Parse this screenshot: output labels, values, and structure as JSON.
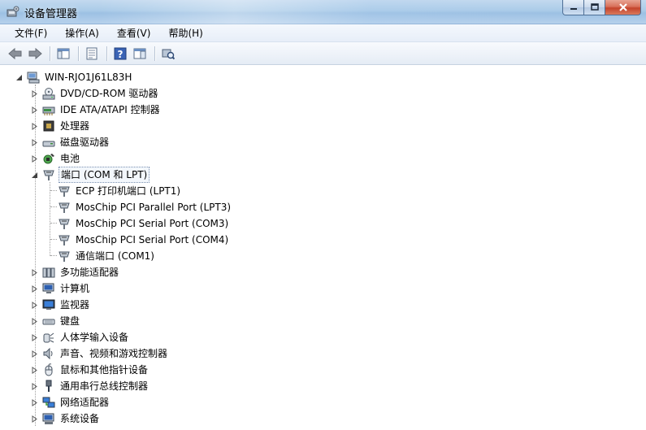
{
  "window": {
    "title": "设备管理器"
  },
  "menu": [
    {
      "label": "文件(F)"
    },
    {
      "label": "操作(A)"
    },
    {
      "label": "查看(V)"
    },
    {
      "label": "帮助(H)"
    }
  ],
  "toolbar": [
    "back-icon",
    "forward-icon",
    "show-hide-console-tree-icon",
    "properties-icon",
    "help-icon",
    "view-icon",
    "scan-hardware-icon"
  ],
  "tree": {
    "root": "WIN-RJO1J61L83H",
    "categories": [
      {
        "label": "DVD/CD-ROM 驱动器",
        "icon": "dvd-drive-icon",
        "expanded": false
      },
      {
        "label": "IDE ATA/ATAPI 控制器",
        "icon": "ide-controller-icon",
        "expanded": false
      },
      {
        "label": "处理器",
        "icon": "processor-icon",
        "expanded": false
      },
      {
        "label": "磁盘驱动器",
        "icon": "disk-drive-icon",
        "expanded": false
      },
      {
        "label": "电池",
        "icon": "battery-icon",
        "expanded": false
      },
      {
        "label": "端口 (COM 和 LPT)",
        "icon": "port-icon",
        "expanded": true,
        "selected": true,
        "children": [
          {
            "label": "ECP 打印机端口 (LPT1)"
          },
          {
            "label": "MosChip PCI Parallel Port (LPT3)"
          },
          {
            "label": "MosChip PCI Serial Port (COM3)"
          },
          {
            "label": "MosChip PCI Serial Port (COM4)"
          },
          {
            "label": "通信端口 (COM1)"
          }
        ]
      },
      {
        "label": "多功能适配器",
        "icon": "multifunction-adapter-icon",
        "expanded": false
      },
      {
        "label": "计算机",
        "icon": "computer-icon",
        "expanded": false
      },
      {
        "label": "监视器",
        "icon": "monitor-icon",
        "expanded": false
      },
      {
        "label": "键盘",
        "icon": "keyboard-icon",
        "expanded": false
      },
      {
        "label": "人体学输入设备",
        "icon": "hid-icon",
        "expanded": false
      },
      {
        "label": "声音、视频和游戏控制器",
        "icon": "sound-icon",
        "expanded": false
      },
      {
        "label": "鼠标和其他指针设备",
        "icon": "mouse-icon",
        "expanded": false
      },
      {
        "label": "通用串行总线控制器",
        "icon": "usb-icon",
        "expanded": false
      },
      {
        "label": "网络适配器",
        "icon": "network-adapter-icon",
        "expanded": false
      },
      {
        "label": "系统设备",
        "icon": "system-device-icon",
        "expanded": false
      }
    ]
  }
}
